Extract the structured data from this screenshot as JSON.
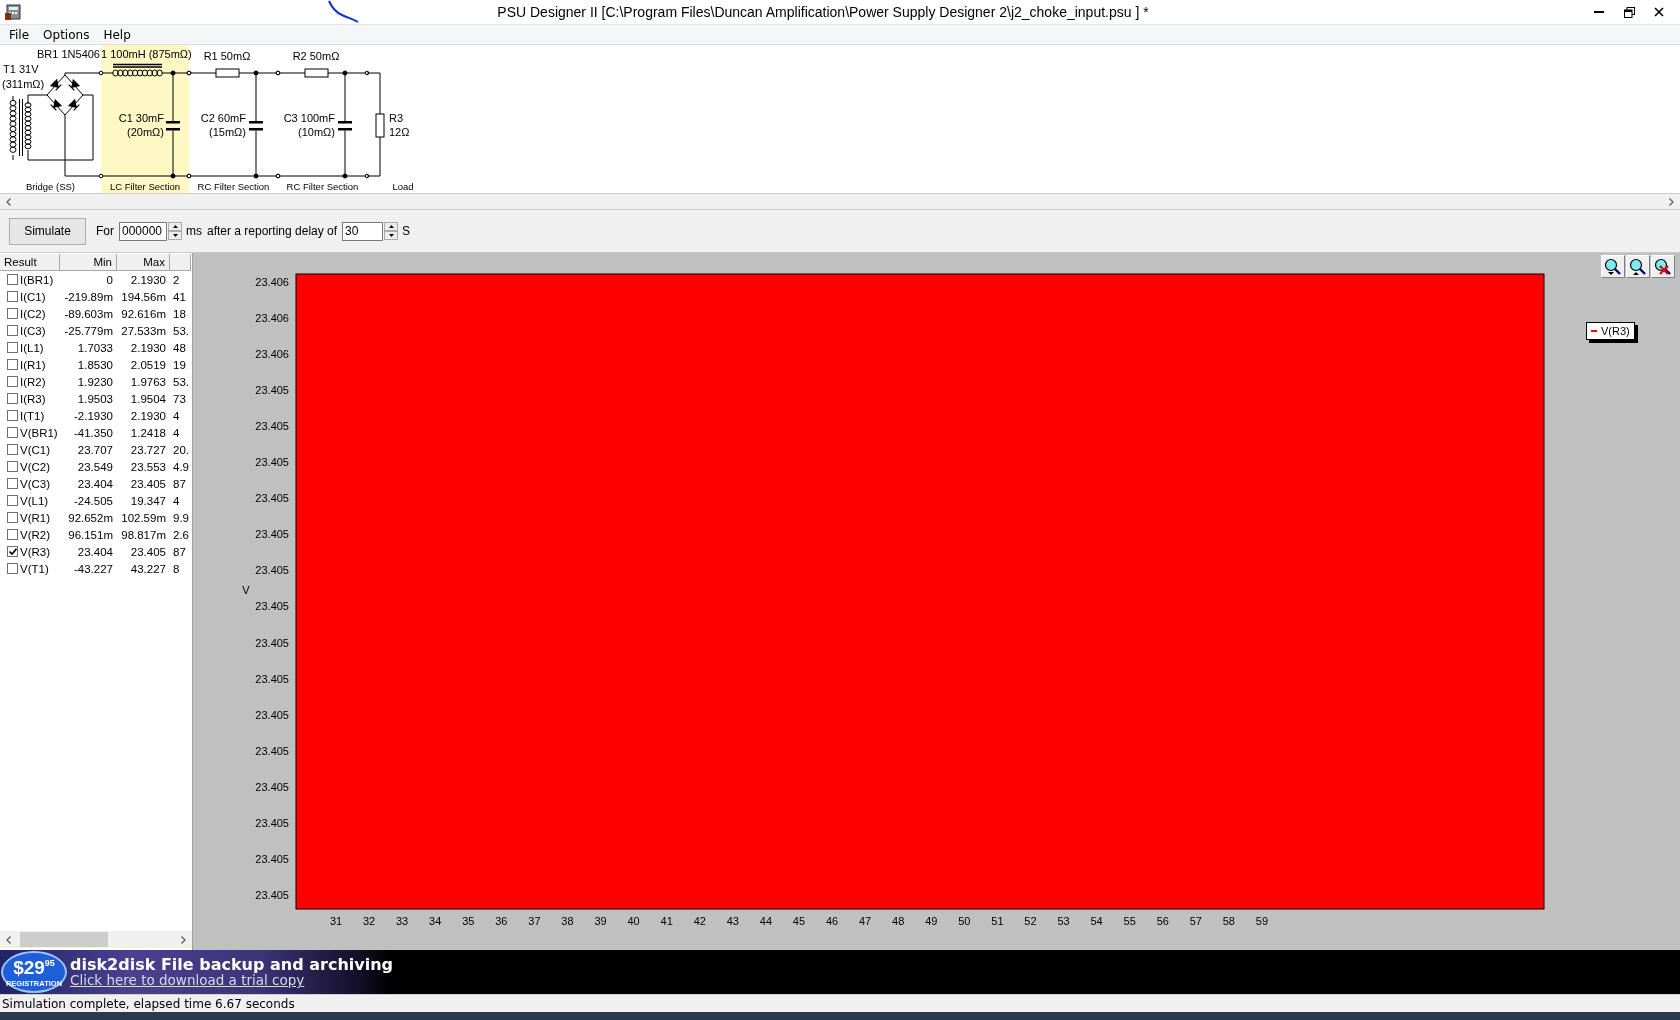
{
  "window": {
    "title": "PSU Designer II  [C:\\Program Files\\Duncan Amplification\\Power Supply Designer 2\\j2_choke_input.psu ] *"
  },
  "menu": [
    "File",
    "Options",
    "Help"
  ],
  "schematic": {
    "sections": [
      {
        "kind": "bridge",
        "label": "Bridge (SS)",
        "selected": false,
        "transformer": [
          "T1 31V",
          "(311mΩ)"
        ],
        "rectifier": "BR1 1N5406"
      },
      {
        "kind": "lc",
        "label": "LC Filter Section",
        "selected": true,
        "series": "1 100mH (875mΩ)",
        "shunt": [
          "C1 30mF",
          "(20mΩ)"
        ]
      },
      {
        "kind": "rc",
        "label": "RC Filter Section",
        "selected": false,
        "series": "R1 50mΩ",
        "shunt": [
          "C2 60mF",
          "(15mΩ)"
        ]
      },
      {
        "kind": "rc",
        "label": "RC Filter Section",
        "selected": false,
        "series": "R2 50mΩ",
        "shunt": [
          "C3 100mF",
          "(10mΩ)"
        ]
      },
      {
        "kind": "load",
        "label": "Load",
        "selected": false,
        "shunt": [
          "R3",
          "12Ω"
        ]
      }
    ]
  },
  "toolbar": {
    "button": "Simulate",
    "for_label": "For",
    "duration": "000000",
    "duration_unit": "ms",
    "delay_label": "after a reporting delay of",
    "delay": "30",
    "delay_unit": "S"
  },
  "results": {
    "columns": [
      "Result",
      "Min",
      "Max"
    ],
    "rows": [
      {
        "name": "I(BR1)",
        "min": "0",
        "max": "2.1930",
        "column_4": "2",
        "checked": false
      },
      {
        "name": "I(C1)",
        "min": "-219.89m",
        "max": "194.56m",
        "column_4": "41",
        "checked": false
      },
      {
        "name": "I(C2)",
        "min": "-89.603m",
        "max": "92.616m",
        "column_4": "18",
        "checked": false
      },
      {
        "name": "I(C3)",
        "min": "-25.779m",
        "max": "27.533m",
        "column_4": "53.",
        "checked": false
      },
      {
        "name": "I(L1)",
        "min": "1.7033",
        "max": "2.1930",
        "column_4": "48",
        "checked": false
      },
      {
        "name": "I(R1)",
        "min": "1.8530",
        "max": "2.0519",
        "column_4": "19",
        "checked": false
      },
      {
        "name": "I(R2)",
        "min": "1.9230",
        "max": "1.9763",
        "column_4": "53.",
        "checked": false
      },
      {
        "name": "I(R3)",
        "min": "1.9503",
        "max": "1.9504",
        "column_4": "73",
        "checked": false
      },
      {
        "name": "I(T1)",
        "min": "-2.1930",
        "max": "2.1930",
        "column_4": "4",
        "checked": false
      },
      {
        "name": "V(BR1)",
        "min": "-41.350",
        "max": "1.2418",
        "column_4": "4",
        "checked": false
      },
      {
        "name": "V(C1)",
        "min": "23.707",
        "max": "23.727",
        "column_4": "20.",
        "checked": false
      },
      {
        "name": "V(C2)",
        "min": "23.549",
        "max": "23.553",
        "column_4": "4.9",
        "checked": false
      },
      {
        "name": "V(C3)",
        "min": "23.404",
        "max": "23.405",
        "column_4": "87",
        "checked": false
      },
      {
        "name": "V(L1)",
        "min": "-24.505",
        "max": "19.347",
        "column_4": "4",
        "checked": false
      },
      {
        "name": "V(R1)",
        "min": "92.652m",
        "max": "102.59m",
        "column_4": "9.9",
        "checked": false
      },
      {
        "name": "V(R2)",
        "min": "96.151m",
        "max": "98.817m",
        "column_4": "2.6",
        "checked": false
      },
      {
        "name": "V(R3)",
        "min": "23.404",
        "max": "23.405",
        "column_4": "87",
        "checked": true
      },
      {
        "name": "V(T1)",
        "min": "-43.227",
        "max": "43.227",
        "column_4": "8",
        "checked": false
      }
    ]
  },
  "graph": {
    "y_axis_label": "V",
    "y_tick_labels": [
      "23.406",
      "23.406",
      "23.406",
      "23.405",
      "23.405",
      "23.405",
      "23.405",
      "23.405",
      "23.405",
      "23.405",
      "23.405",
      "23.405",
      "23.405",
      "23.405",
      "23.405",
      "23.405",
      "23.405",
      "23.405"
    ],
    "x_tick_labels": [
      "31",
      "32",
      "33",
      "34",
      "35",
      "36",
      "37",
      "38",
      "39",
      "40",
      "41",
      "42",
      "43",
      "44",
      "45",
      "46",
      "47",
      "48",
      "49",
      "50",
      "51",
      "52",
      "53",
      "54",
      "55",
      "56",
      "57",
      "58",
      "59"
    ],
    "legend": [
      {
        "label": "V(R3)",
        "color": "#ff0000"
      }
    ]
  },
  "ad": {
    "price": "$29",
    "cents": "95",
    "badge_caption": "REGISTRATION",
    "headline": "disk2disk File backup and archiving",
    "link": "Click here to download a trial copy"
  },
  "status_bar": "Simulation complete, elapsed time 6.67 seconds"
}
